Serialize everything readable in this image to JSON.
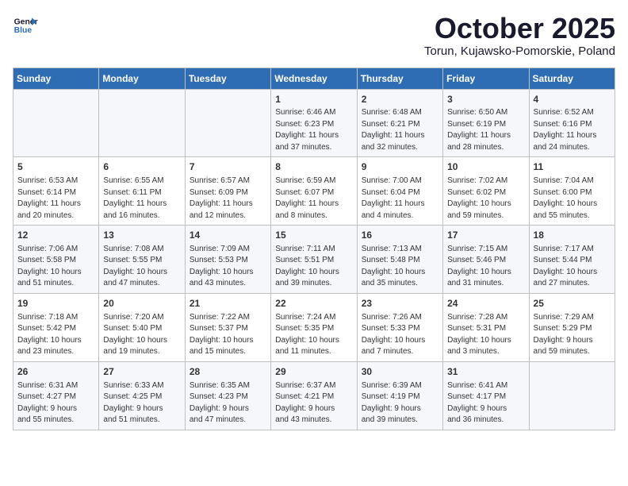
{
  "logo": {
    "line1": "General",
    "line2": "Blue"
  },
  "title": "October 2025",
  "location": "Torun, Kujawsko-Pomorskie, Poland",
  "days_of_week": [
    "Sunday",
    "Monday",
    "Tuesday",
    "Wednesday",
    "Thursday",
    "Friday",
    "Saturday"
  ],
  "weeks": [
    [
      {
        "day": "",
        "info": ""
      },
      {
        "day": "",
        "info": ""
      },
      {
        "day": "",
        "info": ""
      },
      {
        "day": "1",
        "info": "Sunrise: 6:46 AM\nSunset: 6:23 PM\nDaylight: 11 hours\nand 37 minutes."
      },
      {
        "day": "2",
        "info": "Sunrise: 6:48 AM\nSunset: 6:21 PM\nDaylight: 11 hours\nand 32 minutes."
      },
      {
        "day": "3",
        "info": "Sunrise: 6:50 AM\nSunset: 6:19 PM\nDaylight: 11 hours\nand 28 minutes."
      },
      {
        "day": "4",
        "info": "Sunrise: 6:52 AM\nSunset: 6:16 PM\nDaylight: 11 hours\nand 24 minutes."
      }
    ],
    [
      {
        "day": "5",
        "info": "Sunrise: 6:53 AM\nSunset: 6:14 PM\nDaylight: 11 hours\nand 20 minutes."
      },
      {
        "day": "6",
        "info": "Sunrise: 6:55 AM\nSunset: 6:11 PM\nDaylight: 11 hours\nand 16 minutes."
      },
      {
        "day": "7",
        "info": "Sunrise: 6:57 AM\nSunset: 6:09 PM\nDaylight: 11 hours\nand 12 minutes."
      },
      {
        "day": "8",
        "info": "Sunrise: 6:59 AM\nSunset: 6:07 PM\nDaylight: 11 hours\nand 8 minutes."
      },
      {
        "day": "9",
        "info": "Sunrise: 7:00 AM\nSunset: 6:04 PM\nDaylight: 11 hours\nand 4 minutes."
      },
      {
        "day": "10",
        "info": "Sunrise: 7:02 AM\nSunset: 6:02 PM\nDaylight: 10 hours\nand 59 minutes."
      },
      {
        "day": "11",
        "info": "Sunrise: 7:04 AM\nSunset: 6:00 PM\nDaylight: 10 hours\nand 55 minutes."
      }
    ],
    [
      {
        "day": "12",
        "info": "Sunrise: 7:06 AM\nSunset: 5:58 PM\nDaylight: 10 hours\nand 51 minutes."
      },
      {
        "day": "13",
        "info": "Sunrise: 7:08 AM\nSunset: 5:55 PM\nDaylight: 10 hours\nand 47 minutes."
      },
      {
        "day": "14",
        "info": "Sunrise: 7:09 AM\nSunset: 5:53 PM\nDaylight: 10 hours\nand 43 minutes."
      },
      {
        "day": "15",
        "info": "Sunrise: 7:11 AM\nSunset: 5:51 PM\nDaylight: 10 hours\nand 39 minutes."
      },
      {
        "day": "16",
        "info": "Sunrise: 7:13 AM\nSunset: 5:48 PM\nDaylight: 10 hours\nand 35 minutes."
      },
      {
        "day": "17",
        "info": "Sunrise: 7:15 AM\nSunset: 5:46 PM\nDaylight: 10 hours\nand 31 minutes."
      },
      {
        "day": "18",
        "info": "Sunrise: 7:17 AM\nSunset: 5:44 PM\nDaylight: 10 hours\nand 27 minutes."
      }
    ],
    [
      {
        "day": "19",
        "info": "Sunrise: 7:18 AM\nSunset: 5:42 PM\nDaylight: 10 hours\nand 23 minutes."
      },
      {
        "day": "20",
        "info": "Sunrise: 7:20 AM\nSunset: 5:40 PM\nDaylight: 10 hours\nand 19 minutes."
      },
      {
        "day": "21",
        "info": "Sunrise: 7:22 AM\nSunset: 5:37 PM\nDaylight: 10 hours\nand 15 minutes."
      },
      {
        "day": "22",
        "info": "Sunrise: 7:24 AM\nSunset: 5:35 PM\nDaylight: 10 hours\nand 11 minutes."
      },
      {
        "day": "23",
        "info": "Sunrise: 7:26 AM\nSunset: 5:33 PM\nDaylight: 10 hours\nand 7 minutes."
      },
      {
        "day": "24",
        "info": "Sunrise: 7:28 AM\nSunset: 5:31 PM\nDaylight: 10 hours\nand 3 minutes."
      },
      {
        "day": "25",
        "info": "Sunrise: 7:29 AM\nSunset: 5:29 PM\nDaylight: 9 hours\nand 59 minutes."
      }
    ],
    [
      {
        "day": "26",
        "info": "Sunrise: 6:31 AM\nSunset: 4:27 PM\nDaylight: 9 hours\nand 55 minutes."
      },
      {
        "day": "27",
        "info": "Sunrise: 6:33 AM\nSunset: 4:25 PM\nDaylight: 9 hours\nand 51 minutes."
      },
      {
        "day": "28",
        "info": "Sunrise: 6:35 AM\nSunset: 4:23 PM\nDaylight: 9 hours\nand 47 minutes."
      },
      {
        "day": "29",
        "info": "Sunrise: 6:37 AM\nSunset: 4:21 PM\nDaylight: 9 hours\nand 43 minutes."
      },
      {
        "day": "30",
        "info": "Sunrise: 6:39 AM\nSunset: 4:19 PM\nDaylight: 9 hours\nand 39 minutes."
      },
      {
        "day": "31",
        "info": "Sunrise: 6:41 AM\nSunset: 4:17 PM\nDaylight: 9 hours\nand 36 minutes."
      },
      {
        "day": "",
        "info": ""
      }
    ]
  ]
}
